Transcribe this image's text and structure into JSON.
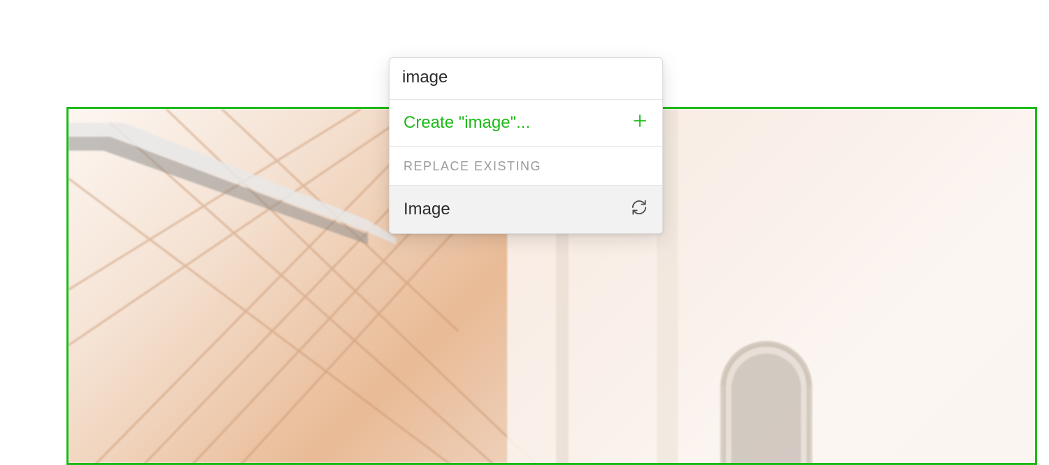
{
  "dropdown": {
    "search_value": "image",
    "create_label": "Create \"image\"...",
    "section_header": "REPLACE EXISTING",
    "options": [
      {
        "label": "Image"
      }
    ]
  },
  "colors": {
    "accent_green": "#1db916"
  }
}
